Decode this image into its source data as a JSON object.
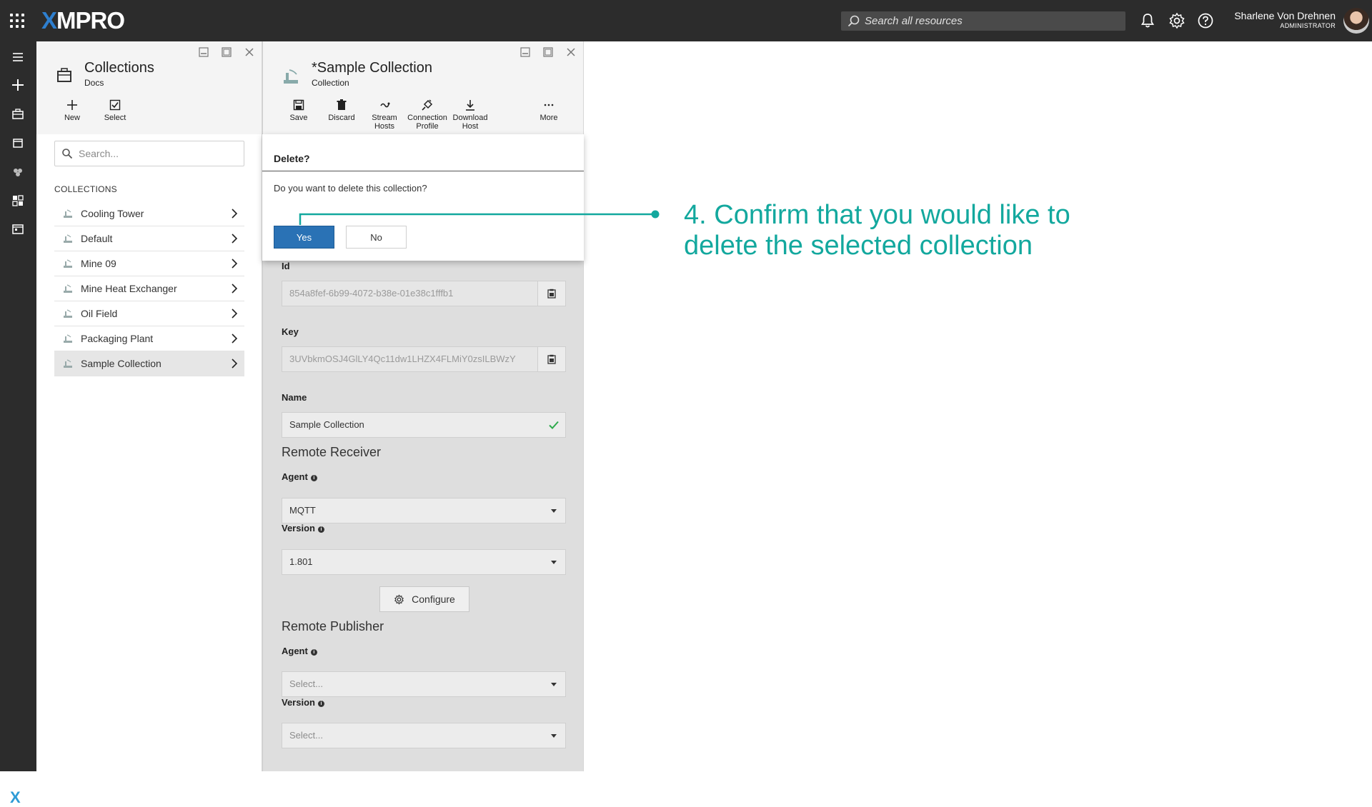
{
  "app": {
    "logo_prefix": "X",
    "logo_rest": "MPRO",
    "search_placeholder": "Search all resources",
    "user_name": "Sharlene Von Drehnen",
    "user_role": "ADMINISTRATOR"
  },
  "colors": {
    "accent_teal": "#13a89e",
    "primary_blue": "#2a72b5",
    "topbar": "#2c2c2c"
  },
  "collections_panel": {
    "title": "Collections",
    "subtitle": "Docs",
    "toolbar": {
      "new_label": "New",
      "select_label": "Select"
    },
    "search_placeholder": "Search...",
    "section_label": "COLLECTIONS",
    "items": [
      {
        "label": "Cooling Tower"
      },
      {
        "label": "Default"
      },
      {
        "label": "Mine 09"
      },
      {
        "label": "Mine Heat Exchanger"
      },
      {
        "label": "Oil Field"
      },
      {
        "label": "Packaging Plant"
      },
      {
        "label": "Sample Collection",
        "selected": true
      }
    ]
  },
  "detail_panel": {
    "title": "*Sample Collection",
    "subtitle": "Collection",
    "toolbar": {
      "save": "Save",
      "discard": "Discard",
      "stream_hosts_1": "Stream",
      "stream_hosts_2": "Hosts",
      "connection_profile_1": "Connection",
      "connection_profile_2": "Profile",
      "download_host_1": "Download",
      "download_host_2": "Host",
      "more": "More"
    },
    "form": {
      "id_label": "Id",
      "id_value": "854a8fef-6b99-4072-b38e-01e38c1fffb1",
      "key_label": "Key",
      "key_value": "3UVbkmOSJ4GlLY4Qc11dw1LHZX4FLMiY0zsILBWzY",
      "name_label": "Name",
      "name_value": "Sample Collection",
      "remote_receiver_title": "Remote Receiver",
      "rr_agent_label": "Agent",
      "rr_agent_value": "MQTT",
      "rr_version_label": "Version",
      "rr_version_value": "1.801",
      "configure_label": "Configure",
      "remote_publisher_title": "Remote Publisher",
      "rp_agent_label": "Agent",
      "rp_agent_value": "Select...",
      "rp_version_label": "Version",
      "rp_version_value": "Select..."
    }
  },
  "dialog": {
    "title": "Delete?",
    "message": "Do you want to delete this collection?",
    "yes_label": "Yes",
    "no_label": "No"
  },
  "annotation": {
    "line1": "4. Confirm that you would like to",
    "line2": "delete the selected collection"
  }
}
